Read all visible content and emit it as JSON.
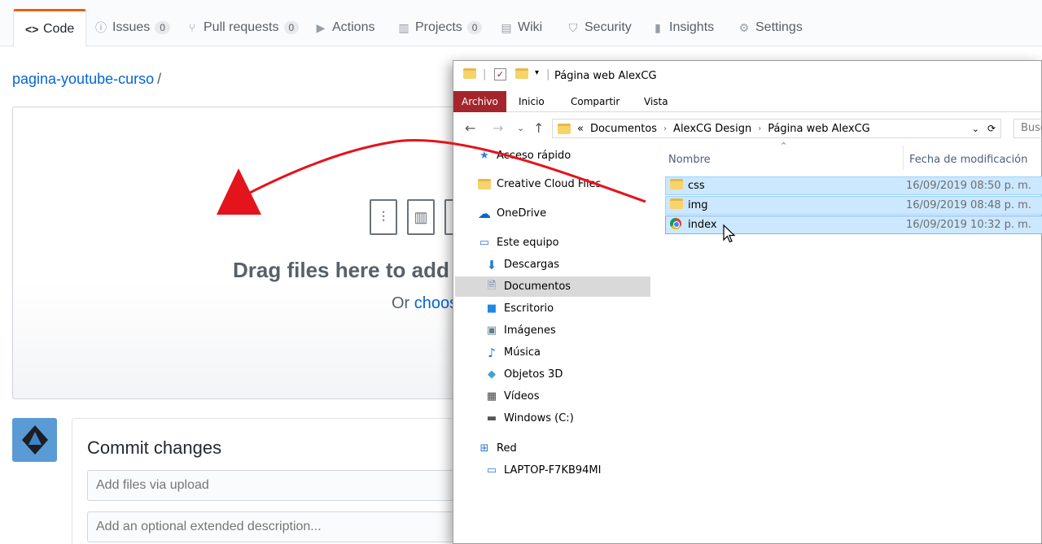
{
  "github": {
    "tabs": [
      {
        "label": "Code",
        "icon": "code-icon",
        "glyph": "<>",
        "counter": ""
      },
      {
        "label": "Issues",
        "icon": "issue-icon",
        "glyph": "ⓘ",
        "counter": "0"
      },
      {
        "label": "Pull requests",
        "icon": "pull-request-icon",
        "glyph": "⑂",
        "counter": "0"
      },
      {
        "label": "Actions",
        "icon": "play-icon",
        "glyph": "▶",
        "counter": ""
      },
      {
        "label": "Projects",
        "icon": "project-icon",
        "glyph": "▥",
        "counter": "0"
      },
      {
        "label": "Wiki",
        "icon": "book-icon",
        "glyph": "▤",
        "counter": ""
      },
      {
        "label": "Security",
        "icon": "shield-icon",
        "glyph": "⛉",
        "counter": ""
      },
      {
        "label": "Insights",
        "icon": "graph-icon",
        "glyph": "▮",
        "counter": ""
      },
      {
        "label": "Settings",
        "icon": "gear-icon",
        "glyph": "⚙",
        "counter": ""
      }
    ],
    "repo_name": "pagina-youtube-curso",
    "path_sep": "/",
    "dropzone": {
      "title": "Drag files here to add",
      "sub_prefix": "Or",
      "sub_link": "choos"
    },
    "commit": {
      "title": "Commit changes",
      "summary_placeholder": "Add files via upload",
      "description_placeholder": "Add an optional extended description..."
    }
  },
  "explorer": {
    "title": "Página web AlexCG",
    "ribbon_tabs": [
      "Archivo",
      "Inicio",
      "Compartir",
      "Vista"
    ],
    "address": [
      "«",
      "Documentos",
      "AlexCG Design",
      "Página web AlexCG"
    ],
    "search_placeholder": "Busc",
    "nav": [
      {
        "label": "Acceso rápido",
        "icon": "star-icon"
      },
      {
        "label": "Creative Cloud Files",
        "icon": "creative-cloud-icon"
      },
      {
        "label": "OneDrive",
        "icon": "cloud-icon"
      },
      {
        "label": "Este equipo",
        "icon": "computer-icon"
      },
      {
        "label": "Descargas",
        "icon": "download-icon"
      },
      {
        "label": "Documentos",
        "icon": "document-icon"
      },
      {
        "label": "Escritorio",
        "icon": "desktop-icon"
      },
      {
        "label": "Imágenes",
        "icon": "image-icon"
      },
      {
        "label": "Música",
        "icon": "music-icon"
      },
      {
        "label": "Objetos 3D",
        "icon": "cube-icon"
      },
      {
        "label": "Vídeos",
        "icon": "video-icon"
      },
      {
        "label": "Windows (C:)",
        "icon": "drive-icon"
      },
      {
        "label": "Red",
        "icon": "network-icon"
      },
      {
        "label": "LAPTOP-F7KB94MI",
        "icon": "monitor-icon"
      }
    ],
    "columns": {
      "name": "Nombre",
      "modified": "Fecha de modificación"
    },
    "files": [
      {
        "name": "css",
        "date": "16/09/2019 08:50 p. m.",
        "icon": "folder-icon"
      },
      {
        "name": "img",
        "date": "16/09/2019 08:48 p. m.",
        "icon": "folder-icon"
      },
      {
        "name": "index",
        "date": "16/09/2019 10:32 p. m.",
        "icon": "chrome-icon"
      }
    ]
  },
  "colors": {
    "github_accent": "#e36209",
    "link": "#0366d6",
    "arrow": "#e3141b",
    "selection": "#cce8ff",
    "ribbon_file": "#a4262c"
  }
}
